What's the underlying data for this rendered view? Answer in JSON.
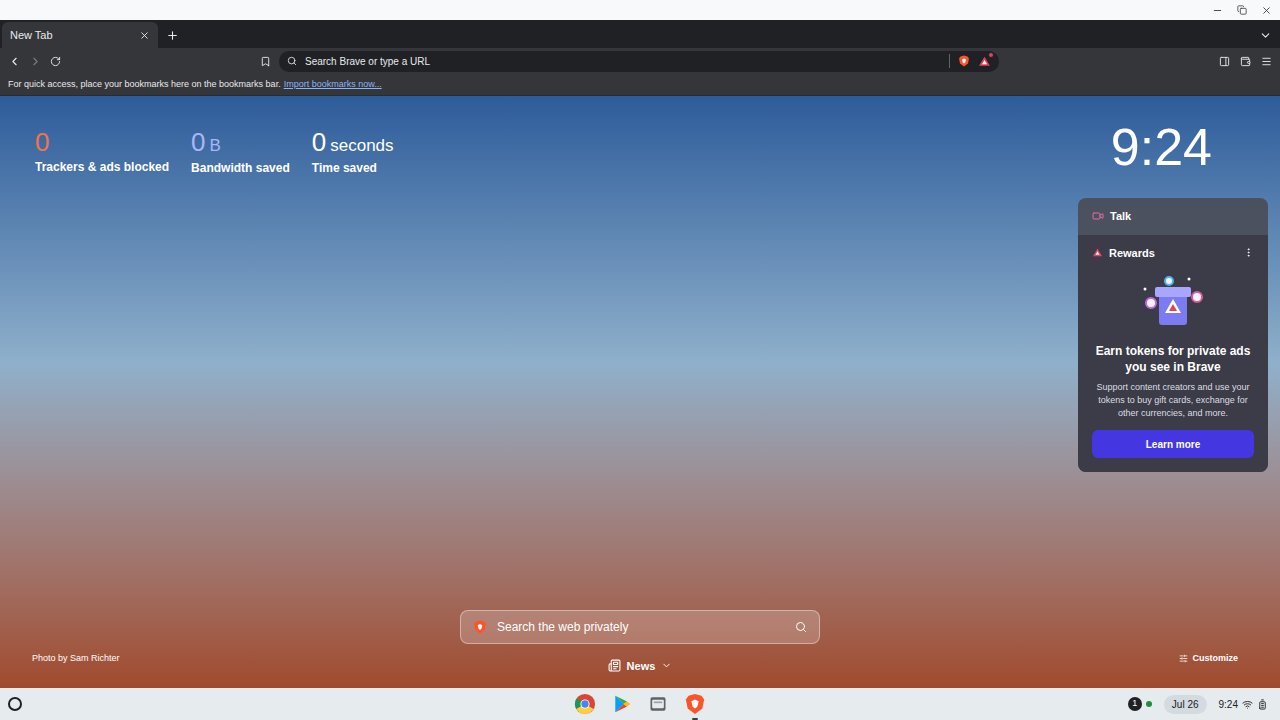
{
  "tabs": [
    {
      "label": "New Tab",
      "selected": true
    }
  ],
  "toolbar": {
    "address_placeholder": "Search Brave or type a URL",
    "rewards_notification": true
  },
  "bookmarks_bar": {
    "message": "For quick access, place your bookmarks here on the bookmarks bar.",
    "link": "Import bookmarks now..."
  },
  "stats": [
    {
      "value": "0",
      "unit": "",
      "label": "Trackers & ads blocked",
      "color": "#f0744a"
    },
    {
      "value": "0",
      "unit": "B",
      "label": "Bandwidth saved",
      "color": "#a9b6f7"
    },
    {
      "value": "0",
      "unit": "seconds",
      "label": "Time saved",
      "color": "#ffffff"
    }
  ],
  "clock": "9:24",
  "widgets": [
    {
      "title": "Talk",
      "expanded": false
    },
    {
      "title": "Rewards",
      "expanded": true,
      "heading": "Earn tokens for private ads you see in Brave",
      "body": "Support content creators and use your tokens to buy gift cards, exchange for other currencies, and more.",
      "button": "Learn more"
    }
  ],
  "search": {
    "placeholder": "Search the web privately"
  },
  "news": {
    "label": "News"
  },
  "photo_credit": "Photo by Sam Richter",
  "customize": "Customize",
  "shelf": {
    "apps": [
      {
        "kind": "chrome",
        "running": false
      },
      {
        "kind": "play",
        "running": false
      },
      {
        "kind": "files",
        "running": false
      },
      {
        "kind": "brave",
        "running": true
      }
    ],
    "status": {
      "notifications": "1",
      "date": "Jul 26",
      "time": "9:24"
    }
  }
}
